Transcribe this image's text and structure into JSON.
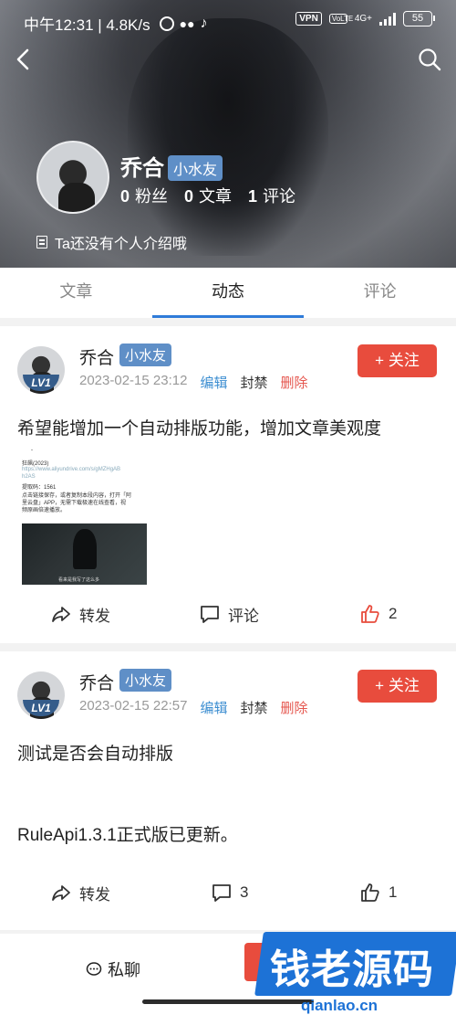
{
  "status_bar": {
    "time_speed": "中午12:31 | 4.8K/s",
    "vpn": "VPN",
    "volte": "VoLTE",
    "net": "4G+",
    "battery": "55"
  },
  "profile": {
    "name": "乔合",
    "badge": "小水友",
    "fans_count": "0",
    "fans_label": "粉丝",
    "articles_count": "0",
    "articles_label": "文章",
    "comments_count": "1",
    "comments_label": "评论",
    "bio": "Ta还没有个人介绍哦"
  },
  "tabs": [
    {
      "label": "文章",
      "active": false
    },
    {
      "label": "动态",
      "active": true
    },
    {
      "label": "评论",
      "active": false
    }
  ],
  "posts": [
    {
      "author": "乔合",
      "badge": "小水友",
      "level": "LV1",
      "date": "2023-02-15 23:12",
      "edit": "编辑",
      "ban": "封禁",
      "delete": "删除",
      "follow": "+ 关注",
      "text": "希望能增加一个自动排版功能，增加文章美观度",
      "thumb_lines": [
        "狂飙(2023)",
        "https://www.aliyundrive.com/s/gMZHgAB",
        "h2AS",
        "提取码：1561",
        "点击链接保存，或者复制本段内容，打开「阿",
        "里云盘」APP，无需下载极速在线查看，视",
        "频原画倍速播放。"
      ],
      "video_caption": "看来是我写了这么多",
      "share": "转发",
      "comment": "评论",
      "likes": "2"
    },
    {
      "author": "乔合",
      "badge": "小水友",
      "level": "LV1",
      "date": "2023-02-15 22:57",
      "edit": "编辑",
      "ban": "封禁",
      "delete": "删除",
      "follow": "+ 关注",
      "text": "测试是否会自动排版",
      "text2": "RuleApi1.3.1正式版已更新。",
      "share": "转发",
      "comments_count": "3",
      "likes": "1"
    }
  ],
  "bottom_bar": {
    "private_msg": "私聊"
  },
  "watermark": {
    "title": "钱老源码",
    "url": "qianlao.cn"
  },
  "colors": {
    "accent_blue": "#2f7bd9",
    "badge_blue": "#5f8fc7",
    "follow_red": "#e84c3d",
    "edit_blue": "#3c8ed1",
    "delete_red": "#e5564e"
  }
}
